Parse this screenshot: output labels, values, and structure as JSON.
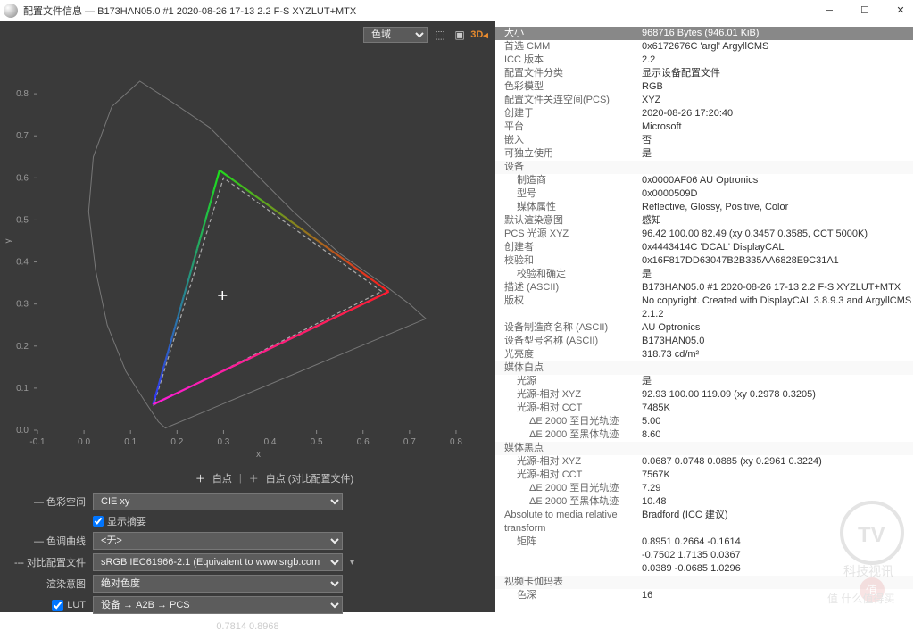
{
  "window": {
    "title": "配置文件信息 — B173HAN05.0 #1 2020-08-26 17-13 2.2 F-S XYZLUT+MTX"
  },
  "toolbar": {
    "gamut_label": "色域",
    "icon_load": "load-icon",
    "icon_save": "save-icon",
    "icon_3d": "3D"
  },
  "chart_data": {
    "type": "chromaticity-xy",
    "xlabel": "x",
    "ylabel": "y",
    "xlim": [
      -0.1,
      0.85
    ],
    "ylim": [
      0.0,
      0.9
    ],
    "xticks": [
      -0.1,
      0.0,
      0.1,
      0.2,
      0.3,
      0.4,
      0.5,
      0.6,
      0.7,
      0.8
    ],
    "yticks": [
      0.0,
      0.1,
      0.2,
      0.3,
      0.4,
      0.5,
      0.6,
      0.7,
      0.8
    ],
    "spectral_locus_outline": true,
    "whitepoint": {
      "x": 0.2978,
      "y": 0.3205
    },
    "profile_gamut": {
      "r": [
        0.6552,
        0.3294
      ],
      "g": [
        0.2915,
        0.6182
      ],
      "b": [
        0.1485,
        0.061
      ]
    },
    "reference_gamut_name": "sRGB IEC61966-2.1",
    "reference_gamut": {
      "r": [
        0.64,
        0.33
      ],
      "g": [
        0.3,
        0.6
      ],
      "b": [
        0.15,
        0.06
      ]
    }
  },
  "controls": {
    "whitepoint_legend_profile": "白点",
    "whitepoint_legend_ref": "白点 (对比配置文件)",
    "colorspace_label": "— 色彩空间",
    "colorspace_value": "CIE xy",
    "show_outline_label": "显示摘要",
    "show_outline_checked": true,
    "trc_label": "— 色调曲线",
    "trc_value": "<无>",
    "compare_label": "--- 对比配置文件",
    "compare_value": "sRGB IEC61966-2.1 (Equivalent to www.srgb.com",
    "intent_label": "渲染意图",
    "intent_value": "绝对色度",
    "lut_label": "LUT",
    "lut_checked": true,
    "lut_value": "设备 → A2B → PCS",
    "footer": "0.7814 0.8968"
  },
  "props": [
    {
      "k": "大小",
      "v": "968716 Bytes (946.01 KiB)",
      "hdr": true
    },
    {
      "k": "首选 CMM",
      "v": "0x6172676C 'argl' ArgyllCMS"
    },
    {
      "k": "ICC 版本",
      "v": "2.2"
    },
    {
      "k": "配置文件分类",
      "v": "显示设备配置文件"
    },
    {
      "k": "色彩模型",
      "v": "RGB"
    },
    {
      "k": "配置文件关连空间(PCS)",
      "v": "XYZ"
    },
    {
      "k": "创建于",
      "v": "2020-08-26 17:20:40"
    },
    {
      "k": "平台",
      "v": "Microsoft"
    },
    {
      "k": "嵌入",
      "v": "否"
    },
    {
      "k": "可独立使用",
      "v": "是"
    },
    {
      "k": "设备",
      "v": "",
      "sec": true
    },
    {
      "k": "制造商",
      "v": "0x0000AF06 AU Optronics",
      "ind": 1
    },
    {
      "k": "型号",
      "v": "0x0000509D",
      "ind": 1
    },
    {
      "k": "媒体属性",
      "v": "Reflective, Glossy, Positive, Color",
      "ind": 1
    },
    {
      "k": "默认渲染意图",
      "v": "感知"
    },
    {
      "k": "PCS 光源 XYZ",
      "v": "96.42 100.00  82.49 (xy 0.3457 0.3585, CCT 5000K)"
    },
    {
      "k": "创建者",
      "v": "0x4443414C 'DCAL' DisplayCAL"
    },
    {
      "k": "校验和",
      "v": "0x16F817DD63047B2B335AA6828E9C31A1"
    },
    {
      "k": "校验和确定",
      "v": "是",
      "ind": 1
    },
    {
      "k": "描述 (ASCII)",
      "v": "B173HAN05.0 #1 2020-08-26 17-13 2.2 F-S XYZLUT+MTX"
    },
    {
      "k": "版权",
      "v": "No copyright. Created with DisplayCAL 3.8.9.3 and ArgyllCMS 2.1.2"
    },
    {
      "k": "设备制造商名称 (ASCII)",
      "v": "AU Optronics"
    },
    {
      "k": "设备型号名称 (ASCII)",
      "v": "B173HAN05.0"
    },
    {
      "k": "光亮度",
      "v": "318.73 cd/m²"
    },
    {
      "k": "媒体白点",
      "v": "",
      "sec": true
    },
    {
      "k": "光源",
      "v": "是",
      "ind": 1
    },
    {
      "k": "光源-相对 XYZ",
      "v": "92.93 100.00 119.09 (xy 0.2978 0.3205)",
      "ind": 1
    },
    {
      "k": "光源-相对 CCT",
      "v": "7485K",
      "ind": 1
    },
    {
      "k": "ΔE 2000 至日光轨迹",
      "v": "5.00",
      "ind": 2
    },
    {
      "k": "ΔE 2000 至黑体轨迹",
      "v": "8.60",
      "ind": 2
    },
    {
      "k": "媒体黑点",
      "v": "",
      "sec": true
    },
    {
      "k": "光源-相对 XYZ",
      "v": "0.0687 0.0748 0.0885 (xy 0.2961 0.3224)",
      "ind": 1
    },
    {
      "k": "光源-相对 CCT",
      "v": "7567K",
      "ind": 1
    },
    {
      "k": "ΔE 2000 至日光轨迹",
      "v": "7.29",
      "ind": 2
    },
    {
      "k": "ΔE 2000 至黑体轨迹",
      "v": "10.48",
      "ind": 2
    },
    {
      "k": "Absolute to media relative transform",
      "v": "Bradford (ICC 建议)"
    },
    {
      "k": "矩阵",
      "v": "0.8951 0.2664 -0.1614",
      "ind": 1
    },
    {
      "k": "",
      "v": "-0.7502 1.7135 0.0367",
      "ind": 1
    },
    {
      "k": "",
      "v": "0.0389 -0.0685 1.0296",
      "ind": 1
    },
    {
      "k": "视频卡伽玛表",
      "v": "",
      "sec": true
    },
    {
      "k": "色深",
      "v": "16",
      "ind": 1
    }
  ],
  "watermark": {
    "text1": "科技视讯",
    "text2": "值 什么值得买"
  }
}
